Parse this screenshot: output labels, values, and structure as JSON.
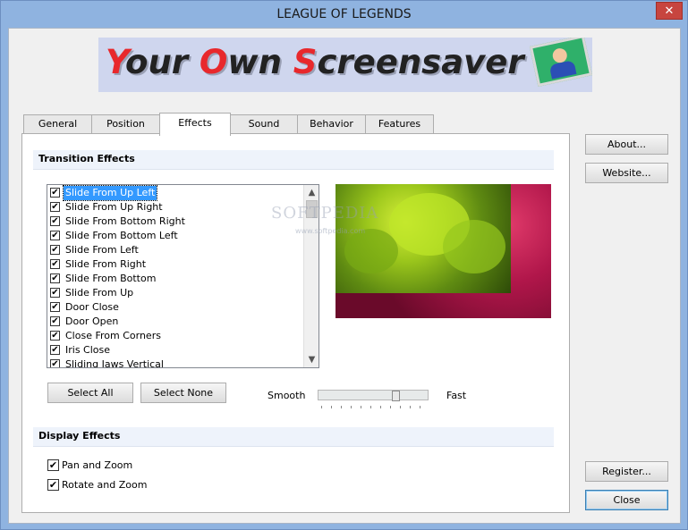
{
  "window": {
    "title": "LEAGUE OF LEGENDS",
    "close_glyph": "✕"
  },
  "banner": {
    "text_before": "Your ",
    "o1": "O",
    "middle1": "wn ",
    "s": "S",
    "rest": "creensaver",
    "y": "Y"
  },
  "tabs": [
    {
      "label": "General"
    },
    {
      "label": "Position"
    },
    {
      "label": "Effects",
      "active": true
    },
    {
      "label": "Sound"
    },
    {
      "label": "Behavior"
    },
    {
      "label": "Features"
    }
  ],
  "transition": {
    "heading": "Transition Effects",
    "items": [
      {
        "label": "Slide From Up Left",
        "checked": true,
        "selected": true
      },
      {
        "label": "Slide From Up Right",
        "checked": true
      },
      {
        "label": "Slide From Bottom Right",
        "checked": true
      },
      {
        "label": "Slide From Bottom Left",
        "checked": true
      },
      {
        "label": "Slide From Left",
        "checked": true
      },
      {
        "label": "Slide From Right",
        "checked": true
      },
      {
        "label": "Slide From Bottom",
        "checked": true
      },
      {
        "label": "Slide From Up",
        "checked": true
      },
      {
        "label": "Door Close",
        "checked": true
      },
      {
        "label": "Door Open",
        "checked": true
      },
      {
        "label": "Close From Corners",
        "checked": true
      },
      {
        "label": "Iris Close",
        "checked": true
      },
      {
        "label": "Sliding Jaws Vertical",
        "checked": true
      }
    ],
    "select_all": "Select All",
    "select_none": "Select None",
    "speed_slow": "Smooth",
    "speed_fast": "Fast",
    "speed_value": 0.72
  },
  "display": {
    "heading": "Display Effects",
    "items": [
      {
        "label": "Pan and Zoom",
        "checked": true
      },
      {
        "label": "Rotate and Zoom",
        "checked": true
      }
    ]
  },
  "side_buttons": {
    "about": "About...",
    "website": "Website...",
    "register": "Register...",
    "close": "Close"
  },
  "watermark": {
    "main": "SOFTPEDIA",
    "sub": "www.softpedia.com"
  },
  "colors": {
    "title_bar": "#8fb3e0",
    "selection": "#3399ff",
    "close_button": "#c7453f"
  },
  "icons": {
    "check": "✔",
    "scroll_up": "▲",
    "scroll_down": "▼"
  }
}
